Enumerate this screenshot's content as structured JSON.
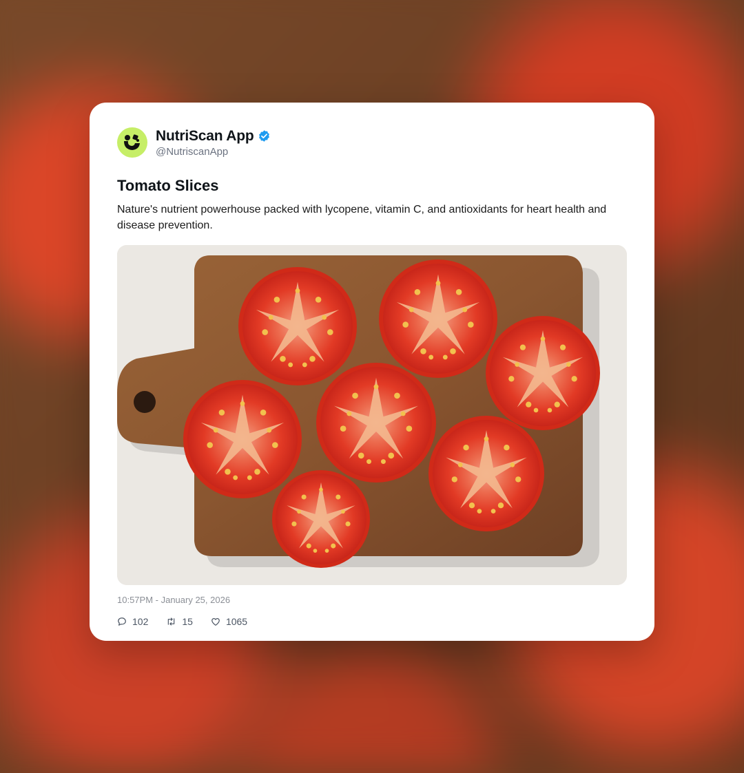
{
  "post": {
    "account_name": "NutriScan App",
    "handle": "@NutriscanApp",
    "title": "Tomato Slices",
    "description": "Nature's nutrient powerhouse packed with lycopene, vitamin C, and antioxidants for heart health and disease prevention.",
    "timestamp": "10:57PM - January 25, 2026",
    "image_alt": "Seven fresh tomato slices arranged on a wooden cutting board",
    "stats": {
      "replies": "102",
      "retweets": "15",
      "likes": "1065"
    }
  },
  "icons": {
    "avatar": "nutriscan-logo-icon",
    "verified": "verified-badge-icon",
    "reply": "comment-icon",
    "retweet": "retweet-icon",
    "like": "heart-icon"
  },
  "colors": {
    "avatar_bg": "#c6ee67",
    "verified": "#1d9bf0",
    "tomato": "#e23a25"
  }
}
